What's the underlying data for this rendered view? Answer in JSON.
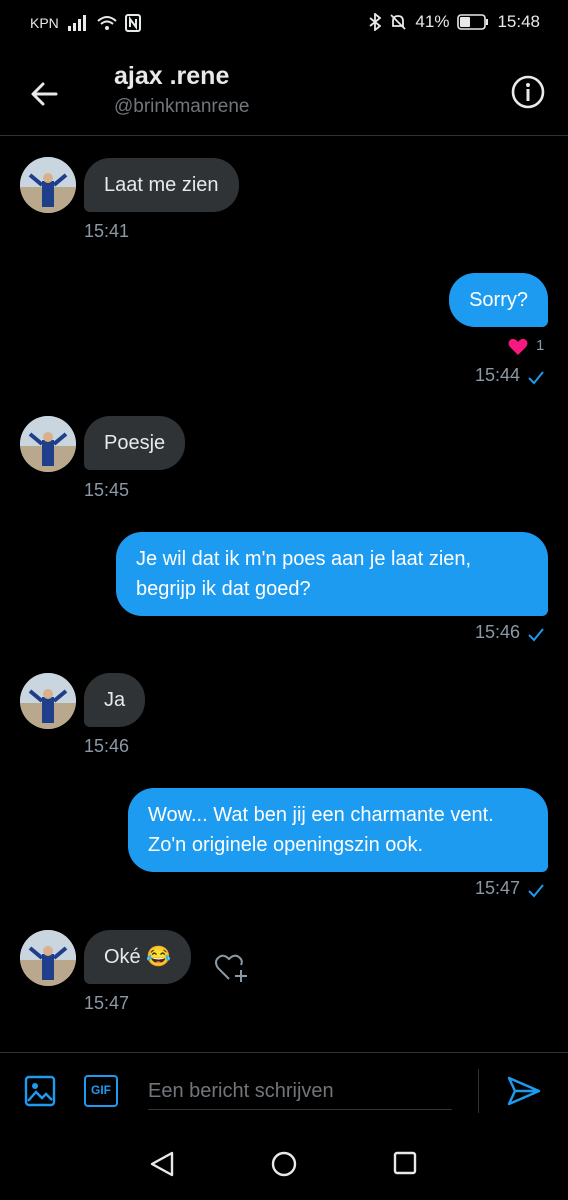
{
  "status_bar": {
    "carrier": "KPN",
    "battery": "41%",
    "time": "15:48"
  },
  "header": {
    "name": "ajax .rene",
    "handle": "@brinkmanrene"
  },
  "messages": [
    {
      "direction": "in",
      "text": "Laat me zien",
      "time": "15:41"
    },
    {
      "direction": "out",
      "text": "Sorry?",
      "time": "15:44",
      "reaction_count": "1"
    },
    {
      "direction": "in",
      "text": "Poesje",
      "time": "15:45"
    },
    {
      "direction": "out",
      "text": "Je wil dat ik m'n poes aan je laat zien, begrijp ik dat goed?",
      "time": "15:46"
    },
    {
      "direction": "in",
      "text": "Ja",
      "time": "15:46"
    },
    {
      "direction": "out",
      "text": "Wow... Wat ben jij een charmante vent. Zo'n originele openingszin ook.",
      "time": "15:47"
    },
    {
      "direction": "in",
      "text": "Oké 😂",
      "time": "15:47"
    }
  ],
  "composer": {
    "placeholder": "Een bericht schrijven",
    "gif_label": "GIF"
  },
  "colors": {
    "accent": "#1d9bf0",
    "incoming_bubble": "#2f3336",
    "heart": "#f91880"
  }
}
